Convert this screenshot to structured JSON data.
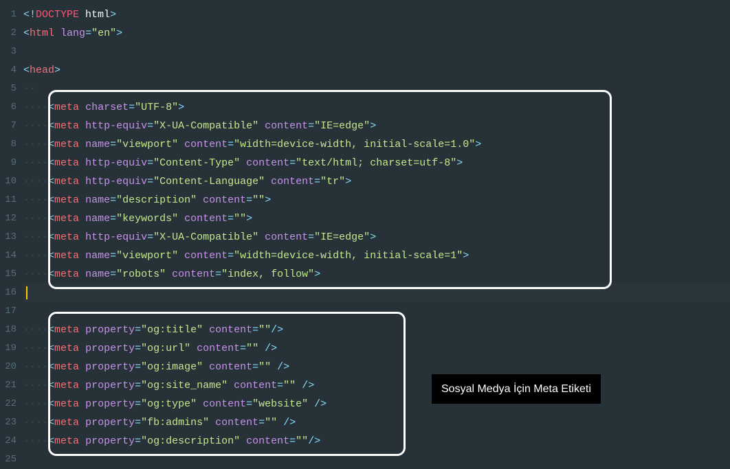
{
  "annotation_label": "Sosyal Medya İçin Meta Etiketi",
  "line_numbers": [
    "1",
    "2",
    "3",
    "4",
    "5",
    "6",
    "7",
    "8",
    "9",
    "10",
    "11",
    "12",
    "13",
    "14",
    "15",
    "16",
    "17",
    "18",
    "19",
    "20",
    "21",
    "22",
    "23",
    "24",
    "25"
  ],
  "lines": [
    {
      "tokens": [
        {
          "t": "<",
          "c": "t-bracket"
        },
        {
          "t": "!",
          "c": "t-bracket"
        },
        {
          "t": "DOCTYPE",
          "c": "t-doctype"
        },
        {
          "t": " html",
          "c": ""
        },
        {
          "t": ">",
          "c": "t-bracket"
        }
      ]
    },
    {
      "tokens": [
        {
          "t": "<",
          "c": "t-bracket"
        },
        {
          "t": "html",
          "c": "t-tag"
        },
        {
          "t": " ",
          "c": ""
        },
        {
          "t": "lang",
          "c": "t-attr"
        },
        {
          "t": "=",
          "c": "t-eq"
        },
        {
          "t": "\"en\"",
          "c": "t-str"
        },
        {
          "t": ">",
          "c": "t-bracket"
        }
      ]
    },
    {
      "tokens": []
    },
    {
      "tokens": [
        {
          "t": "<",
          "c": "t-bracket"
        },
        {
          "t": "head",
          "c": "t-tag"
        },
        {
          "t": ">",
          "c": "t-bracket"
        }
      ]
    },
    {
      "tokens": [
        {
          "t": "··",
          "c": "t-invis"
        }
      ]
    },
    {
      "tokens": [
        {
          "t": "····",
          "c": "t-invis"
        },
        {
          "t": "<",
          "c": "t-bracket"
        },
        {
          "t": "meta",
          "c": "t-tag"
        },
        {
          "t": " ",
          "c": ""
        },
        {
          "t": "charset",
          "c": "t-attr"
        },
        {
          "t": "=",
          "c": "t-eq"
        },
        {
          "t": "\"UTF-8\"",
          "c": "t-str"
        },
        {
          "t": ">",
          "c": "t-bracket"
        }
      ]
    },
    {
      "tokens": [
        {
          "t": "····",
          "c": "t-invis"
        },
        {
          "t": "<",
          "c": "t-bracket"
        },
        {
          "t": "meta",
          "c": "t-tag"
        },
        {
          "t": " ",
          "c": ""
        },
        {
          "t": "http-equiv",
          "c": "t-attr"
        },
        {
          "t": "=",
          "c": "t-eq"
        },
        {
          "t": "\"X-UA-Compatible\"",
          "c": "t-str"
        },
        {
          "t": " ",
          "c": ""
        },
        {
          "t": "content",
          "c": "t-attr"
        },
        {
          "t": "=",
          "c": "t-eq"
        },
        {
          "t": "\"IE=edge\"",
          "c": "t-str"
        },
        {
          "t": ">",
          "c": "t-bracket"
        }
      ]
    },
    {
      "tokens": [
        {
          "t": "····",
          "c": "t-invis"
        },
        {
          "t": "<",
          "c": "t-bracket"
        },
        {
          "t": "meta",
          "c": "t-tag"
        },
        {
          "t": " ",
          "c": ""
        },
        {
          "t": "name",
          "c": "t-attr"
        },
        {
          "t": "=",
          "c": "t-eq"
        },
        {
          "t": "\"viewport\"",
          "c": "t-str"
        },
        {
          "t": " ",
          "c": ""
        },
        {
          "t": "content",
          "c": "t-attr"
        },
        {
          "t": "=",
          "c": "t-eq"
        },
        {
          "t": "\"width=device-width, initial-scale=1.0\"",
          "c": "t-str"
        },
        {
          "t": ">",
          "c": "t-bracket"
        }
      ]
    },
    {
      "tokens": [
        {
          "t": "····",
          "c": "t-invis"
        },
        {
          "t": "<",
          "c": "t-bracket"
        },
        {
          "t": "meta",
          "c": "t-tag"
        },
        {
          "t": " ",
          "c": ""
        },
        {
          "t": "http-equiv",
          "c": "t-attr"
        },
        {
          "t": "=",
          "c": "t-eq"
        },
        {
          "t": "\"Content-Type\"",
          "c": "t-str"
        },
        {
          "t": " ",
          "c": ""
        },
        {
          "t": "content",
          "c": "t-attr"
        },
        {
          "t": "=",
          "c": "t-eq"
        },
        {
          "t": "\"text/html; charset=utf-8\"",
          "c": "t-str"
        },
        {
          "t": ">",
          "c": "t-bracket"
        }
      ]
    },
    {
      "tokens": [
        {
          "t": "····",
          "c": "t-invis"
        },
        {
          "t": "<",
          "c": "t-bracket"
        },
        {
          "t": "meta",
          "c": "t-tag"
        },
        {
          "t": " ",
          "c": ""
        },
        {
          "t": "http-equiv",
          "c": "t-attr"
        },
        {
          "t": "=",
          "c": "t-eq"
        },
        {
          "t": "\"Content-Language\"",
          "c": "t-str"
        },
        {
          "t": " ",
          "c": ""
        },
        {
          "t": "content",
          "c": "t-attr"
        },
        {
          "t": "=",
          "c": "t-eq"
        },
        {
          "t": "\"tr\"",
          "c": "t-str"
        },
        {
          "t": ">",
          "c": "t-bracket"
        }
      ]
    },
    {
      "tokens": [
        {
          "t": "····",
          "c": "t-invis"
        },
        {
          "t": "<",
          "c": "t-bracket"
        },
        {
          "t": "meta",
          "c": "t-tag"
        },
        {
          "t": " ",
          "c": ""
        },
        {
          "t": "name",
          "c": "t-attr"
        },
        {
          "t": "=",
          "c": "t-eq"
        },
        {
          "t": "\"description\"",
          "c": "t-str"
        },
        {
          "t": " ",
          "c": ""
        },
        {
          "t": "content",
          "c": "t-attr"
        },
        {
          "t": "=",
          "c": "t-eq"
        },
        {
          "t": "\"\"",
          "c": "t-str"
        },
        {
          "t": ">",
          "c": "t-bracket"
        }
      ]
    },
    {
      "tokens": [
        {
          "t": "····",
          "c": "t-invis"
        },
        {
          "t": "<",
          "c": "t-bracket"
        },
        {
          "t": "meta",
          "c": "t-tag"
        },
        {
          "t": " ",
          "c": ""
        },
        {
          "t": "name",
          "c": "t-attr"
        },
        {
          "t": "=",
          "c": "t-eq"
        },
        {
          "t": "\"keywords\"",
          "c": "t-str"
        },
        {
          "t": " ",
          "c": ""
        },
        {
          "t": "content",
          "c": "t-attr"
        },
        {
          "t": "=",
          "c": "t-eq"
        },
        {
          "t": "\"\"",
          "c": "t-str"
        },
        {
          "t": ">",
          "c": "t-bracket"
        }
      ]
    },
    {
      "tokens": [
        {
          "t": "····",
          "c": "t-invis"
        },
        {
          "t": "<",
          "c": "t-bracket"
        },
        {
          "t": "meta",
          "c": "t-tag"
        },
        {
          "t": " ",
          "c": ""
        },
        {
          "t": "http-equiv",
          "c": "t-attr"
        },
        {
          "t": "=",
          "c": "t-eq"
        },
        {
          "t": "\"X-UA-Compatible\"",
          "c": "t-str"
        },
        {
          "t": " ",
          "c": ""
        },
        {
          "t": "content",
          "c": "t-attr"
        },
        {
          "t": "=",
          "c": "t-eq"
        },
        {
          "t": "\"IE=edge\"",
          "c": "t-str"
        },
        {
          "t": ">",
          "c": "t-bracket"
        }
      ]
    },
    {
      "tokens": [
        {
          "t": "····",
          "c": "t-invis"
        },
        {
          "t": "<",
          "c": "t-bracket"
        },
        {
          "t": "meta",
          "c": "t-tag"
        },
        {
          "t": " ",
          "c": ""
        },
        {
          "t": "name",
          "c": "t-attr"
        },
        {
          "t": "=",
          "c": "t-eq"
        },
        {
          "t": "\"viewport\"",
          "c": "t-str"
        },
        {
          "t": " ",
          "c": ""
        },
        {
          "t": "content",
          "c": "t-attr"
        },
        {
          "t": "=",
          "c": "t-eq"
        },
        {
          "t": "\"width=device-width, initial-scale=1\"",
          "c": "t-str"
        },
        {
          "t": ">",
          "c": "t-bracket"
        }
      ]
    },
    {
      "tokens": [
        {
          "t": "····",
          "c": "t-invis"
        },
        {
          "t": "<",
          "c": "t-bracket"
        },
        {
          "t": "meta",
          "c": "t-tag"
        },
        {
          "t": " ",
          "c": ""
        },
        {
          "t": "name",
          "c": "t-attr"
        },
        {
          "t": "=",
          "c": "t-eq"
        },
        {
          "t": "\"robots\"",
          "c": "t-str"
        },
        {
          "t": " ",
          "c": ""
        },
        {
          "t": "content",
          "c": "t-attr"
        },
        {
          "t": "=",
          "c": "t-eq"
        },
        {
          "t": "\"index, follow\"",
          "c": "t-str"
        },
        {
          "t": ">",
          "c": "t-bracket"
        }
      ]
    },
    {
      "tokens": [],
      "current": true
    },
    {
      "tokens": []
    },
    {
      "tokens": [
        {
          "t": "····",
          "c": "t-invis"
        },
        {
          "t": "<",
          "c": "t-bracket"
        },
        {
          "t": "meta",
          "c": "t-tag"
        },
        {
          "t": " ",
          "c": ""
        },
        {
          "t": "property",
          "c": "t-attr"
        },
        {
          "t": "=",
          "c": "t-eq"
        },
        {
          "t": "\"og:title\"",
          "c": "t-str"
        },
        {
          "t": " ",
          "c": ""
        },
        {
          "t": "content",
          "c": "t-attr"
        },
        {
          "t": "=",
          "c": "t-eq"
        },
        {
          "t": "\"\"",
          "c": "t-str"
        },
        {
          "t": "/>",
          "c": "t-bracket"
        }
      ]
    },
    {
      "tokens": [
        {
          "t": "····",
          "c": "t-invis"
        },
        {
          "t": "<",
          "c": "t-bracket"
        },
        {
          "t": "meta",
          "c": "t-tag"
        },
        {
          "t": " ",
          "c": ""
        },
        {
          "t": "property",
          "c": "t-attr"
        },
        {
          "t": "=",
          "c": "t-eq"
        },
        {
          "t": "\"og:url\"",
          "c": "t-str"
        },
        {
          "t": " ",
          "c": ""
        },
        {
          "t": "content",
          "c": "t-attr"
        },
        {
          "t": "=",
          "c": "t-eq"
        },
        {
          "t": "\"\"",
          "c": "t-str"
        },
        {
          "t": " />",
          "c": "t-bracket"
        }
      ]
    },
    {
      "tokens": [
        {
          "t": "····",
          "c": "t-invis"
        },
        {
          "t": "<",
          "c": "t-bracket"
        },
        {
          "t": "meta",
          "c": "t-tag"
        },
        {
          "t": " ",
          "c": ""
        },
        {
          "t": "property",
          "c": "t-attr"
        },
        {
          "t": "=",
          "c": "t-eq"
        },
        {
          "t": "\"og:image\"",
          "c": "t-str"
        },
        {
          "t": " ",
          "c": ""
        },
        {
          "t": "content",
          "c": "t-attr"
        },
        {
          "t": "=",
          "c": "t-eq"
        },
        {
          "t": "\"\"",
          "c": "t-str"
        },
        {
          "t": " />",
          "c": "t-bracket"
        }
      ]
    },
    {
      "tokens": [
        {
          "t": "····",
          "c": "t-invis"
        },
        {
          "t": "<",
          "c": "t-bracket"
        },
        {
          "t": "meta",
          "c": "t-tag"
        },
        {
          "t": " ",
          "c": ""
        },
        {
          "t": "property",
          "c": "t-attr"
        },
        {
          "t": "=",
          "c": "t-eq"
        },
        {
          "t": "\"og:site_name\"",
          "c": "t-str"
        },
        {
          "t": " ",
          "c": ""
        },
        {
          "t": "content",
          "c": "t-attr"
        },
        {
          "t": "=",
          "c": "t-eq"
        },
        {
          "t": "\"\"",
          "c": "t-str"
        },
        {
          "t": " />",
          "c": "t-bracket"
        }
      ]
    },
    {
      "tokens": [
        {
          "t": "····",
          "c": "t-invis"
        },
        {
          "t": "<",
          "c": "t-bracket"
        },
        {
          "t": "meta",
          "c": "t-tag"
        },
        {
          "t": " ",
          "c": ""
        },
        {
          "t": "property",
          "c": "t-attr"
        },
        {
          "t": "=",
          "c": "t-eq"
        },
        {
          "t": "\"og:type\"",
          "c": "t-str"
        },
        {
          "t": " ",
          "c": ""
        },
        {
          "t": "content",
          "c": "t-attr"
        },
        {
          "t": "=",
          "c": "t-eq"
        },
        {
          "t": "\"website\"",
          "c": "t-str"
        },
        {
          "t": " />",
          "c": "t-bracket"
        }
      ]
    },
    {
      "tokens": [
        {
          "t": "····",
          "c": "t-invis"
        },
        {
          "t": "<",
          "c": "t-bracket"
        },
        {
          "t": "meta",
          "c": "t-tag"
        },
        {
          "t": " ",
          "c": ""
        },
        {
          "t": "property",
          "c": "t-attr"
        },
        {
          "t": "=",
          "c": "t-eq"
        },
        {
          "t": "\"fb:admins\"",
          "c": "t-str"
        },
        {
          "t": " ",
          "c": ""
        },
        {
          "t": "content",
          "c": "t-attr"
        },
        {
          "t": "=",
          "c": "t-eq"
        },
        {
          "t": "\"\"",
          "c": "t-str"
        },
        {
          "t": " />",
          "c": "t-bracket"
        }
      ]
    },
    {
      "tokens": [
        {
          "t": "····",
          "c": "t-invis"
        },
        {
          "t": "<",
          "c": "t-bracket"
        },
        {
          "t": "meta",
          "c": "t-tag"
        },
        {
          "t": " ",
          "c": ""
        },
        {
          "t": "property",
          "c": "t-attr"
        },
        {
          "t": "=",
          "c": "t-eq"
        },
        {
          "t": "\"og:description\"",
          "c": "t-str"
        },
        {
          "t": " ",
          "c": ""
        },
        {
          "t": "content",
          "c": "t-attr"
        },
        {
          "t": "=",
          "c": "t-eq"
        },
        {
          "t": "\"\"",
          "c": "t-str"
        },
        {
          "t": "/>",
          "c": "t-bracket"
        }
      ]
    },
    {
      "tokens": []
    }
  ]
}
